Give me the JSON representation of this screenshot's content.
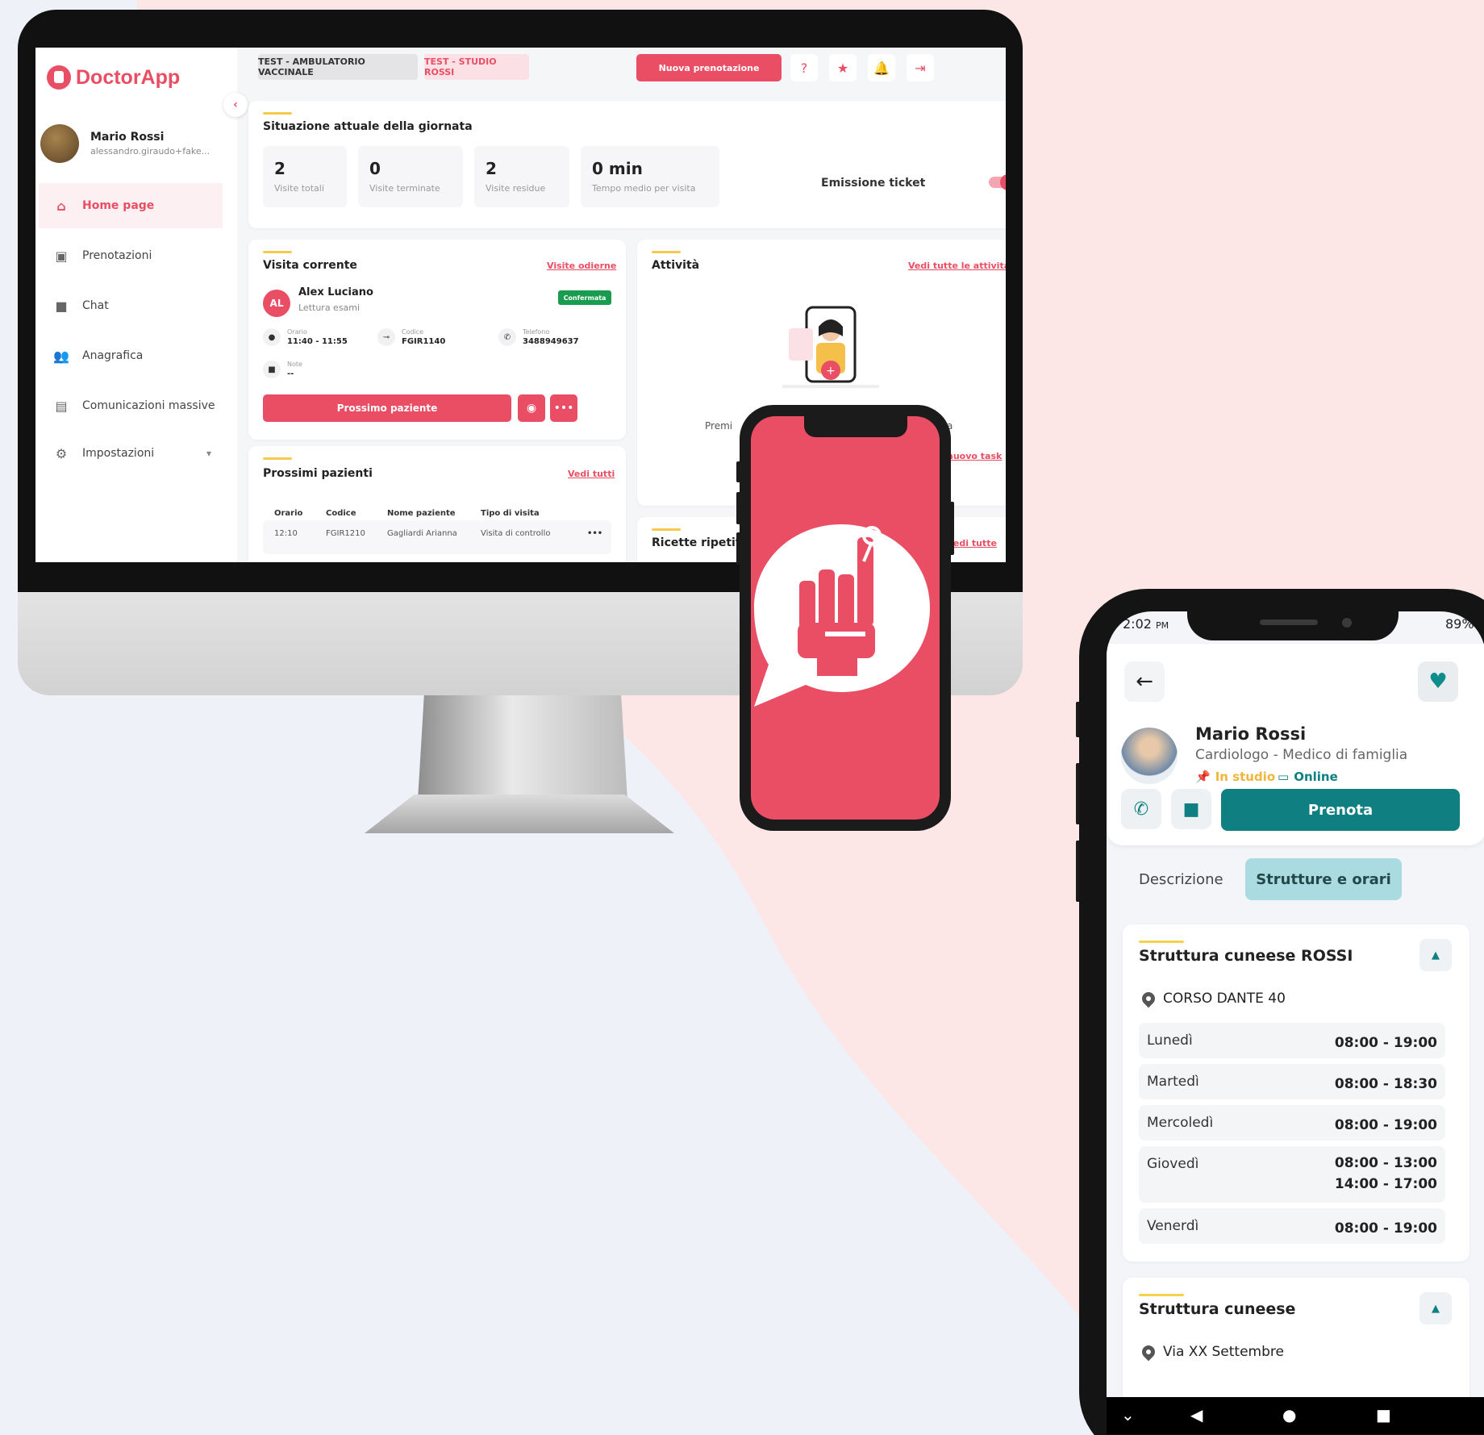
{
  "desktop": {
    "logo": "DoctorApp",
    "user": {
      "name": "Mario Rossi",
      "email": "alessandro.giraudo+fake..."
    },
    "nav": [
      {
        "label": "Home page",
        "icon": "home-icon"
      },
      {
        "label": "Prenotazioni",
        "icon": "calendar-icon"
      },
      {
        "label": "Chat",
        "icon": "chat-icon"
      },
      {
        "label": "Anagrafica",
        "icon": "people-icon"
      },
      {
        "label": "Comunicazioni massive",
        "icon": "announcement-icon"
      },
      {
        "label": "Impostazioni",
        "icon": "gear-icon"
      }
    ],
    "chips": [
      "TEST - AMBULATORIO VACCINALE",
      "TEST - STUDIO ROSSI"
    ],
    "new_booking": "Nuova prenotazione",
    "situation": {
      "title": "Situazione attuale della giornata",
      "stats": [
        {
          "value": "2",
          "label": "Visite totali"
        },
        {
          "value": "0",
          "label": "Visite terminate"
        },
        {
          "value": "2",
          "label": "Visite residue"
        },
        {
          "value": "0 min",
          "label": "Tempo medio per visita"
        }
      ],
      "ticket_label": "Emissione ticket"
    },
    "current": {
      "title": "Visita corrente",
      "link": "Visite odierne",
      "initials": "AL",
      "patient": "Alex Luciano",
      "reason": "Lettura esami",
      "status": "Confermata",
      "orario_label": "Orario",
      "orario": "11:40 - 11:55",
      "codice_label": "Codice",
      "codice": "FGIR1140",
      "telefono_label": "Telefono",
      "telefono": "3488949637",
      "note_label": "Note",
      "note": "--",
      "next_button": "Prossimo paziente"
    },
    "next": {
      "title": "Prossimi pazienti",
      "link": "Vedi tutti",
      "headers": [
        "Orario",
        "Codice",
        "Nome paziente",
        "Tipo di visita"
      ],
      "rows": [
        [
          "12:10",
          "FGIR1210",
          "Gagliardi Arianna",
          "Visita di controllo"
        ]
      ]
    },
    "activity": {
      "title": "Attività",
      "link": "Vedi tutte le attività",
      "text_left": "Premi",
      "text_right": "a",
      "task_link": "nuovo task"
    },
    "recipes": {
      "title": "Ricette ripetitive",
      "link": "Vedi tutte"
    }
  },
  "mobile": {
    "status_time": "2:02",
    "status_ampm": "PM",
    "battery": "89%",
    "doctor": {
      "name": "Mario Rossi",
      "specialty": "Cardiologo - Medico di famiglia",
      "tag1": "In studio",
      "tag2": "Online"
    },
    "book": "Prenota",
    "tabs": [
      "Descrizione",
      "Strutture e orari"
    ],
    "structure1": {
      "title": "Struttura cuneese ROSSI",
      "address": "CORSO DANTE 40",
      "hours": [
        {
          "day": "Lunedì",
          "time": "08:00 - 19:00"
        },
        {
          "day": "Martedì",
          "time": "08:00 - 18:30"
        },
        {
          "day": "Mercoledì",
          "time": "08:00 - 19:00"
        },
        {
          "day": "Giovedì",
          "time": "08:00 - 13:00",
          "time2": "14:00 - 17:00"
        },
        {
          "day": "Venerdì",
          "time": "08:00 - 19:00"
        }
      ]
    },
    "structure2": {
      "title": "Struttura cuneese",
      "address": "Via XX Settembre"
    }
  },
  "colors": {
    "brand": "#e94e64",
    "teal": "#0f7f82",
    "background": "#eef2f8",
    "blob": "#fde6e6"
  }
}
